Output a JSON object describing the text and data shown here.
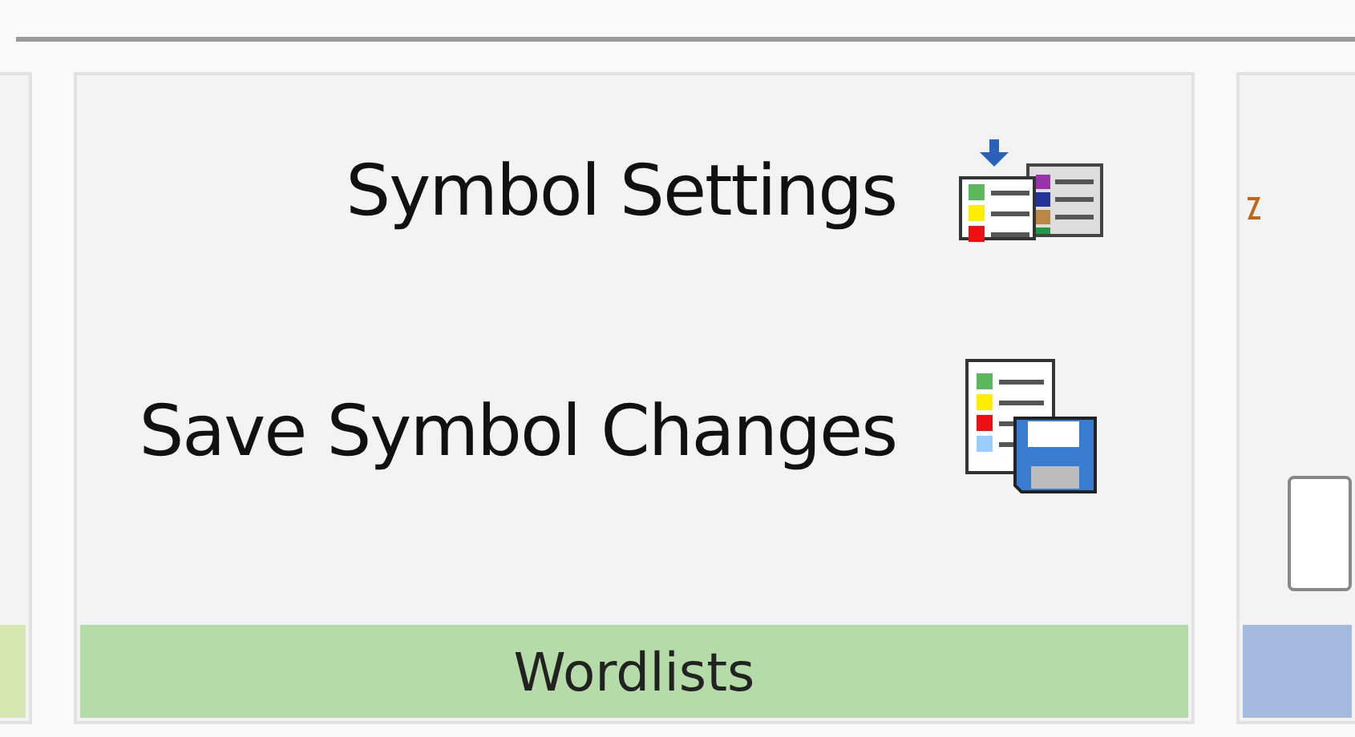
{
  "groups": [
    {
      "color": "#d6e8b0"
    },
    {
      "color": "#b5dba8",
      "label": "Wordlists",
      "buttons": [
        {
          "kind": "load",
          "label": "Symbol Settings"
        },
        {
          "kind": "save",
          "label": "Save Symbol Changes"
        }
      ]
    },
    {
      "color": "#a5b8df",
      "kind": "field"
    }
  ]
}
